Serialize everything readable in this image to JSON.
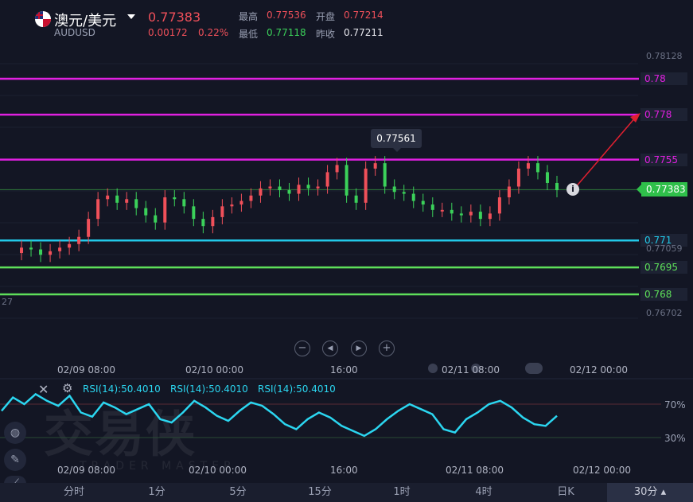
{
  "header": {
    "title": "澳元/美元",
    "symbol": "AUDUSD",
    "price": "0.77383",
    "change": "0.00172",
    "change_pct": "0.22%",
    "high_label": "最高",
    "high_value": "0.77536",
    "open_label": "开盘",
    "open_value": "0.77214",
    "low_label": "最低",
    "low_value": "0.77118",
    "prev_close_label": "昨收",
    "prev_close_value": "0.77211"
  },
  "levels": [
    {
      "value": 0.78,
      "label": "0.78",
      "color": "#e020e0"
    },
    {
      "value": 0.778,
      "label": "0.778",
      "color": "#e020e0"
    },
    {
      "value": 0.7755,
      "label": "0.7755",
      "color": "#e020e0"
    },
    {
      "value": 0.771,
      "label": "0.771",
      "color": "#22c8e8"
    },
    {
      "value": 0.7695,
      "label": "0.7695",
      "color": "#5ee05a"
    },
    {
      "value": 0.768,
      "label": "0.768",
      "color": "#5ee05a"
    }
  ],
  "price_axis": [
    "0.78128",
    "0.77059",
    "0.76702"
  ],
  "current_price_label": "0.77383",
  "tooltip_value": "0.77561",
  "left_edge_label": "27",
  "time_labels_main": [
    "02/09 08:00",
    "02/10 00:00",
    "16:00",
    "02/11 08:00",
    "02/12 00:00"
  ],
  "time_labels_rsi": [
    "02/09 08:00",
    "02/10 00:00",
    "16:00",
    "02/11 08:00",
    "02/12 00:00"
  ],
  "rsi": {
    "labels": [
      "RSI(14):50.4010",
      "RSI(14):50.4010",
      "RSI(14):50.4010"
    ],
    "upper": "70%",
    "lower": "30%",
    "line_color": "#2bd6f0"
  },
  "watermark": {
    "text": "交易侠",
    "sub": "TRADER MASTER"
  },
  "controls": {
    "zoom_out": "−",
    "prev": "◀",
    "next": "▶",
    "zoom_in": "+"
  },
  "info_icon": "i",
  "tabs": [
    "分时",
    "1分",
    "5分",
    "15分",
    "1时",
    "4时",
    "日K",
    "30分"
  ],
  "active_tab": "30分",
  "colors": {
    "up": "#f0505a",
    "down": "#3bd15a",
    "background": "#131624"
  }
}
